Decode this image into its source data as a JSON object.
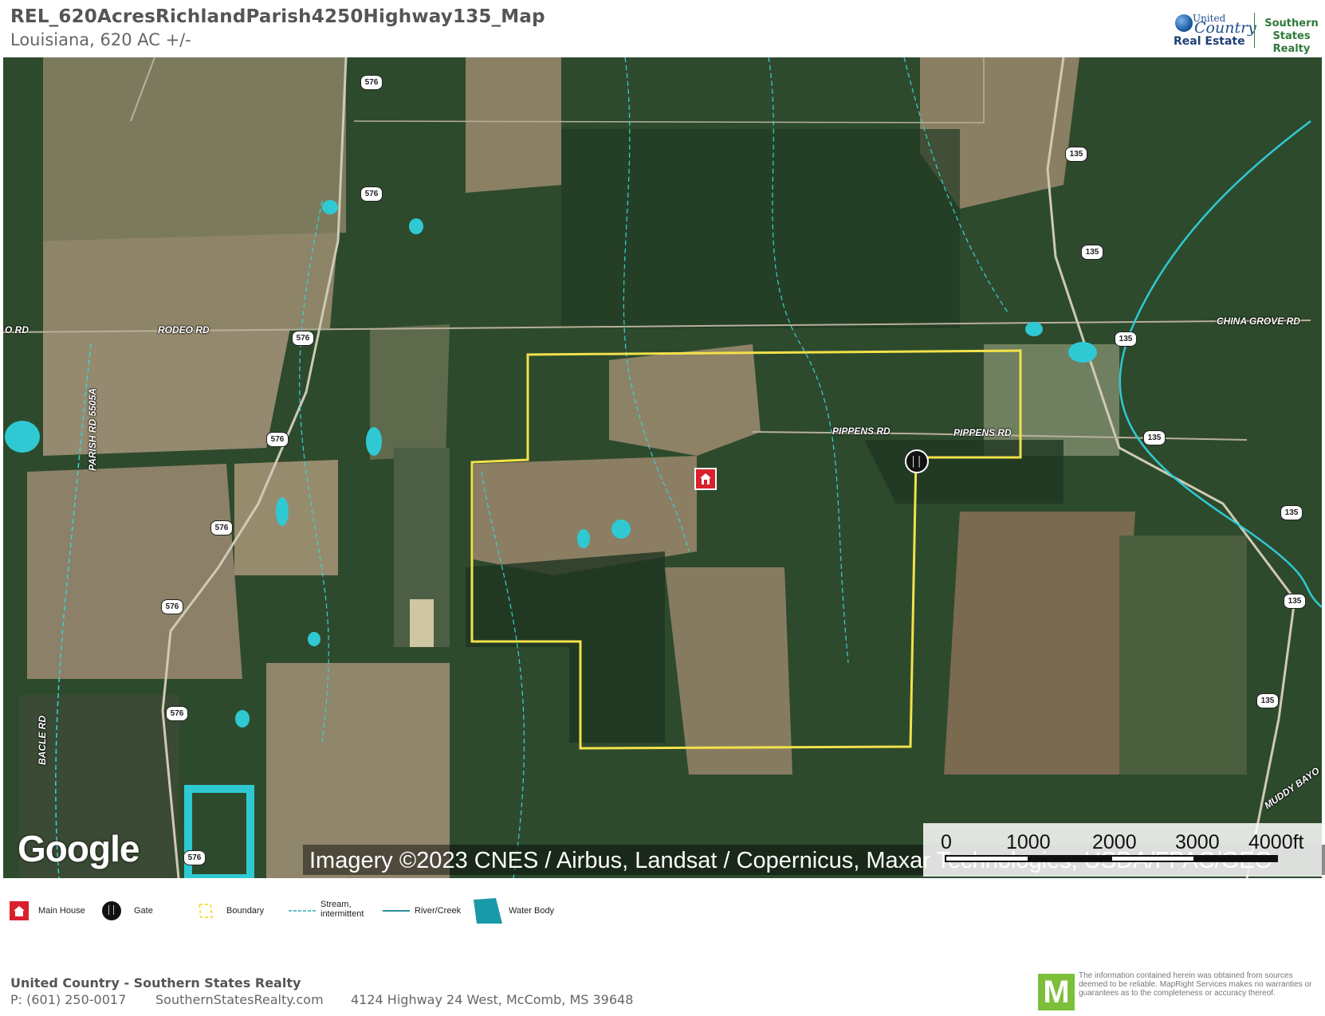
{
  "header": {
    "title": "REL_620AcresRichlandParish4250Highway135_Map",
    "subtitle": "Louisiana, 620 AC +/-"
  },
  "logo": {
    "line1": "United",
    "line2": "Country",
    "line3": "Real Estate",
    "partner_line1": "Southern",
    "partner_line2": "States Realty"
  },
  "map": {
    "road_labels": {
      "rodeo_left": "O RD",
      "rodeo": "RODEO RD",
      "parish": "PARISH RD 5505A",
      "pippens_1": "PIPPENS RD",
      "pippens_2": "PIPPENS RD",
      "china_grove": "CHINA GROVE RD",
      "bacle": "BACLE RD",
      "muddy": "MUDDY BAYO"
    },
    "route_576": "576",
    "route_135": "135",
    "attribution": "Imagery ©2023 CNES / Airbus, Landsat / Copernicus, Maxar Technologies, USDA/FPAC/GEO",
    "google_logo": "Google",
    "scale": {
      "ticks": [
        "0",
        "1000",
        "2000",
        "3000",
        "4000ft"
      ]
    },
    "colors": {
      "boundary": "#f2e14a",
      "water": "#2fc9d4",
      "house_marker": "#d9202c"
    }
  },
  "legend": [
    {
      "icon": "house-icon",
      "label": "Main House"
    },
    {
      "icon": "gate-icon",
      "label": "Gate"
    },
    {
      "icon": "boundary-icon",
      "label": "Boundary"
    },
    {
      "icon": "stream-icon",
      "label": "Stream, intermittent"
    },
    {
      "icon": "river-icon",
      "label": "River/Creek"
    },
    {
      "icon": "water-body-icon",
      "label": "Water Body"
    }
  ],
  "footer": {
    "company": "United Country - Southern States Realty",
    "phone": "P: (601) 250-0017",
    "website": "SouthernStatesRealty.com",
    "address": "4124 Highway 24 West, McComb, MS 39648",
    "mapright_logo": "M",
    "disclaimer": "The information contained herein was obtained from sources deemed to be reliable. MapRight Services makes no warranties or guarantees as to the completeness or accuracy thereof."
  }
}
